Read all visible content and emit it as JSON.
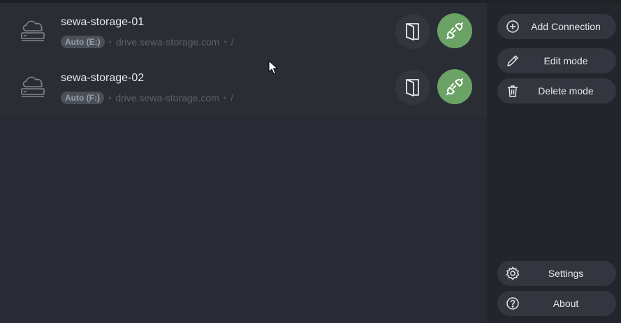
{
  "connections": [
    {
      "name": "sewa-storage-01",
      "mode": "Auto (E:)",
      "host": "drive.sewa-storage.com",
      "path": "/"
    },
    {
      "name": "sewa-storage-02",
      "mode": "Auto (F:)",
      "host": "drive.sewa-storage.com",
      "path": "/"
    }
  ],
  "sidebar": {
    "add_connection": "Add Connection",
    "edit_mode": "Edit mode",
    "delete_mode": "Delete mode",
    "settings": "Settings",
    "about": "About"
  },
  "colors": {
    "background": "#282b33",
    "sidebar": "#22252b",
    "button": "#33363e",
    "connect_green": "#6aa365",
    "text": "#e6e8eb"
  },
  "icons": {
    "drive": "cloud-server-icon",
    "open": "open-folder-icon",
    "connect": "plug-icon",
    "add": "plus-circle-icon",
    "edit": "pencil-icon",
    "delete": "trash-icon",
    "settings": "gear-icon",
    "about": "question-circle-icon"
  }
}
